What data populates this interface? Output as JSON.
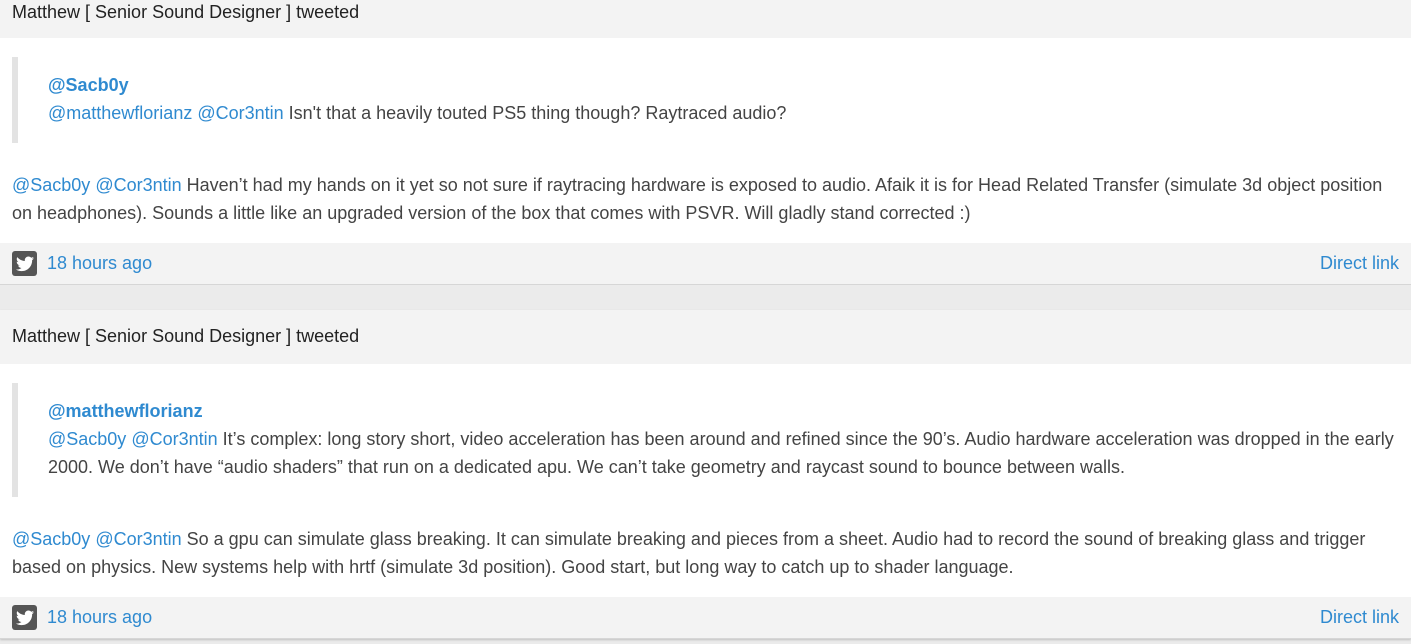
{
  "tweets": [
    {
      "header": "Matthew [ Senior Sound Designer ] tweeted",
      "quote_author": "@Sacb0y",
      "quote_mentions": [
        "@matthewflorianz",
        "@Cor3ntin"
      ],
      "quote_text": " Isn't that a heavily touted PS5 thing though? Raytraced audio?",
      "body_mentions": [
        "@Sacb0y",
        "@Cor3ntin"
      ],
      "body_text": " Haven’t had my hands on it yet so not sure if raytracing hardware is exposed to audio. Afaik it is for Head Related Transfer (simulate 3d object position on headphones). Sounds a little like an upgraded version of the box that comes with PSVR. Will gladly stand corrected :)",
      "time": "18 hours ago",
      "direct_link": "Direct link"
    },
    {
      "header": "Matthew [ Senior Sound Designer ] tweeted",
      "quote_author": "@matthewflorianz",
      "quote_mentions": [
        "@Sacb0y",
        "@Cor3ntin"
      ],
      "quote_text": " It’s complex: long story short, video acceleration has been around and refined since the 90’s. Audio hardware acceleration was dropped in the early 2000. We don’t have “audio shaders” that run on a dedicated apu. We can’t take geometry and raycast sound to bounce between walls.",
      "body_mentions": [
        "@Sacb0y",
        "@Cor3ntin"
      ],
      "body_text": " So a gpu can simulate glass breaking. It can simulate breaking and pieces from a sheet. Audio had to record the sound of breaking glass and trigger based on physics. New systems help with hrtf (simulate 3d position). Good start, but long way to catch up to shader language.",
      "time": "18 hours ago",
      "direct_link": "Direct link"
    }
  ],
  "icons": {
    "footer": "twitter-icon"
  },
  "colors": {
    "link": "#2f8ad0",
    "text": "#444444",
    "header_bg": "#f3f3f3"
  }
}
